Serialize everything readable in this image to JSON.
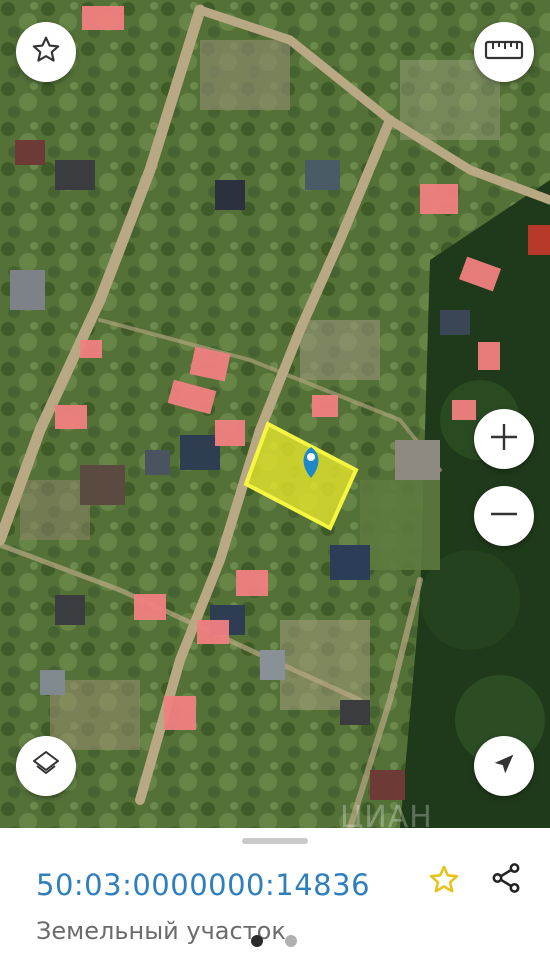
{
  "map": {
    "layer": "satellite",
    "highlight_color": "#e8e82a",
    "building_color": "#f08080",
    "marker_color": "#1e88c8",
    "watermark": "ЦИАН"
  },
  "controls": {
    "favorite_icon": "star-outline-icon",
    "ruler_icon": "ruler-icon",
    "zoom_in_icon": "plus-icon",
    "zoom_out_icon": "minus-icon",
    "layers_icon": "layers-icon",
    "locate_icon": "navigation-arrow-icon"
  },
  "sheet": {
    "cadastral_number": "50:03:0000000:14836",
    "object_type": "Земельный участок",
    "favorite_icon": "star-icon",
    "favorite_color": "#e8c21a",
    "share_icon": "share-icon",
    "pages": {
      "count": 2,
      "active": 1
    }
  }
}
